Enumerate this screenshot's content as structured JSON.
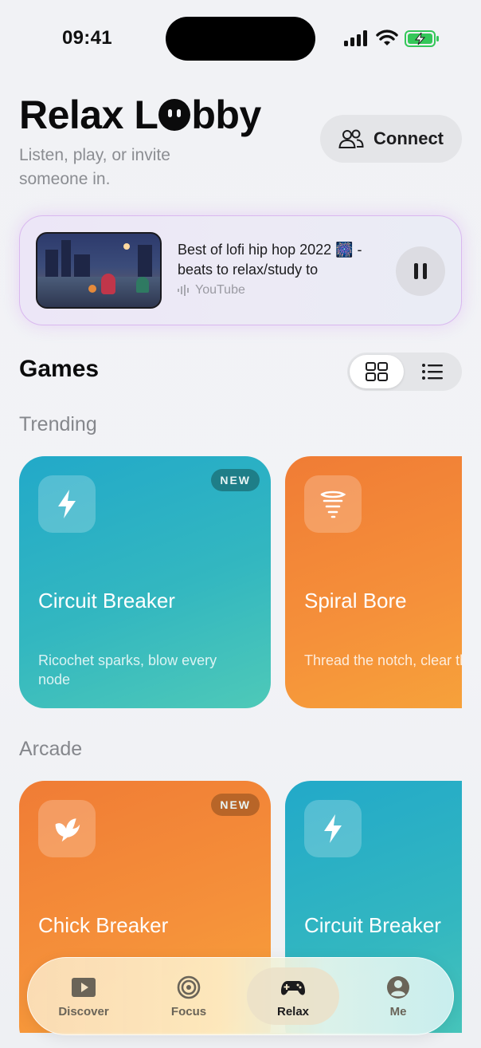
{
  "status_bar": {
    "time": "09:41",
    "icons": [
      "cellular-signal-icon",
      "wifi-icon",
      "battery-charging-icon"
    ]
  },
  "header": {
    "title_part1": "Relax L",
    "title_part2": "bby",
    "subtitle": "Listen, play, or invite someone in.",
    "connect_label": "Connect"
  },
  "now_playing": {
    "title": "Best of lofi hip hop 2022 🎆 - beats to relax/study to",
    "source": "YouTube"
  },
  "games": {
    "title": "Games",
    "view_modes": [
      "grid",
      "list"
    ],
    "active_view": "grid",
    "sections": [
      {
        "label": "Trending",
        "cards": [
          {
            "name": "Circuit Breaker",
            "desc": "Ricochet sparks, blow every node",
            "badge": "NEW",
            "icon": "lightning-bolt-icon",
            "color": "teal"
          },
          {
            "name": "Spiral Bore",
            "desc": "Thread the notch, clear the field",
            "badge": "",
            "icon": "tornado-icon",
            "color": "orange"
          }
        ]
      },
      {
        "label": "Arcade",
        "cards": [
          {
            "name": "Chick Breaker",
            "desc": "",
            "badge": "NEW",
            "icon": "bird-icon",
            "color": "orange"
          },
          {
            "name": "Circuit Breaker",
            "desc": "",
            "badge": "",
            "icon": "lightning-bolt-icon",
            "color": "teal"
          }
        ]
      }
    ]
  },
  "tab_bar": {
    "active": "Relax",
    "tabs": [
      {
        "label": "Discover",
        "icon": "play-square-icon"
      },
      {
        "label": "Focus",
        "icon": "target-icon"
      },
      {
        "label": "Relax",
        "icon": "gamepad-icon"
      },
      {
        "label": "Me",
        "icon": "person-circle-icon"
      }
    ]
  },
  "colors": {
    "teal_card": "#2fb3c4",
    "orange_card": "#f38b38",
    "now_playing_glow": "#d9b8ef",
    "text_secondary": "#8b8d92"
  }
}
